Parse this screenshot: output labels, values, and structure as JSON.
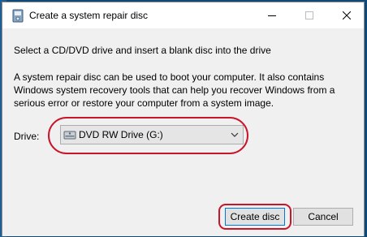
{
  "window": {
    "title": "Create a system repair disc",
    "title_icon": "repair-disc-icon",
    "controls": {
      "minimize_icon": "minimize-icon",
      "maximize_icon": "maximize-icon",
      "close_icon": "close-icon"
    }
  },
  "content": {
    "instruction": "Select a CD/DVD drive and insert a blank disc into the drive",
    "description": "A system repair disc can be used to boot your computer. It also contains Windows system recovery tools that can help you recover Windows from a serious error or restore your computer from a system image.",
    "drive": {
      "label": "Drive:",
      "selected_value": "DVD RW Drive (G:)",
      "icon": "dvd-drive-icon"
    }
  },
  "footer": {
    "create_label": "Create disc",
    "cancel_label": "Cancel"
  },
  "colors": {
    "highlight_oval": "#c8152a",
    "dialog_bg": "#f0f0f0",
    "button_bg": "#e1e1e1",
    "focus_border": "#0078d7"
  }
}
